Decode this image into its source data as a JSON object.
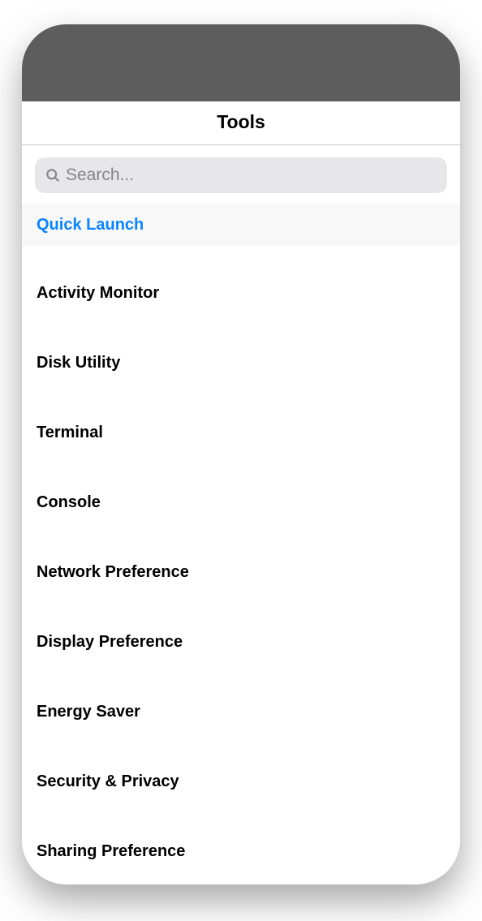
{
  "header": {
    "title": "Tools"
  },
  "search": {
    "placeholder": "Search..."
  },
  "list": {
    "section_label": "Quick Launch",
    "items": [
      {
        "label": "Activity Monitor"
      },
      {
        "label": "Disk Utility"
      },
      {
        "label": "Terminal"
      },
      {
        "label": "Console"
      },
      {
        "label": "Network Preference"
      },
      {
        "label": "Display Preference"
      },
      {
        "label": "Energy Saver"
      },
      {
        "label": "Security & Privacy"
      },
      {
        "label": "Sharing Preference"
      }
    ]
  }
}
